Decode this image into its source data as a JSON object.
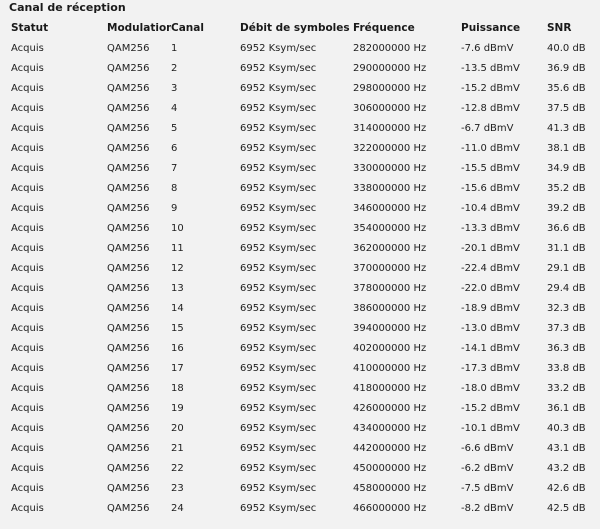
{
  "section": {
    "title": "Canal de réception"
  },
  "table": {
    "headers": {
      "status": "Statut",
      "modulation": "Modulation",
      "channel": "Canal",
      "symbol_rate": "Débit de symboles",
      "frequency": "Fréquence",
      "power": "Puissance",
      "snr": "SNR"
    },
    "rows": [
      {
        "status": "Acquis",
        "modulation": "QAM256",
        "channel": "1",
        "symbol_rate": "6952 Ksym/sec",
        "frequency": "282000000 Hz",
        "power": "-7.6 dBmV",
        "snr": "40.0 dB"
      },
      {
        "status": "Acquis",
        "modulation": "QAM256",
        "channel": "2",
        "symbol_rate": "6952 Ksym/sec",
        "frequency": "290000000 Hz",
        "power": "-13.5 dBmV",
        "snr": "36.9 dB"
      },
      {
        "status": "Acquis",
        "modulation": "QAM256",
        "channel": "3",
        "symbol_rate": "6952 Ksym/sec",
        "frequency": "298000000 Hz",
        "power": "-15.2 dBmV",
        "snr": "35.6 dB"
      },
      {
        "status": "Acquis",
        "modulation": "QAM256",
        "channel": "4",
        "symbol_rate": "6952 Ksym/sec",
        "frequency": "306000000 Hz",
        "power": "-12.8 dBmV",
        "snr": "37.5 dB"
      },
      {
        "status": "Acquis",
        "modulation": "QAM256",
        "channel": "5",
        "symbol_rate": "6952 Ksym/sec",
        "frequency": "314000000 Hz",
        "power": "-6.7 dBmV",
        "snr": "41.3 dB"
      },
      {
        "status": "Acquis",
        "modulation": "QAM256",
        "channel": "6",
        "symbol_rate": "6952 Ksym/sec",
        "frequency": "322000000 Hz",
        "power": "-11.0 dBmV",
        "snr": "38.1 dB"
      },
      {
        "status": "Acquis",
        "modulation": "QAM256",
        "channel": "7",
        "symbol_rate": "6952 Ksym/sec",
        "frequency": "330000000 Hz",
        "power": "-15.5 dBmV",
        "snr": "34.9 dB"
      },
      {
        "status": "Acquis",
        "modulation": "QAM256",
        "channel": "8",
        "symbol_rate": "6952 Ksym/sec",
        "frequency": "338000000 Hz",
        "power": "-15.6 dBmV",
        "snr": "35.2 dB"
      },
      {
        "status": "Acquis",
        "modulation": "QAM256",
        "channel": "9",
        "symbol_rate": "6952 Ksym/sec",
        "frequency": "346000000 Hz",
        "power": "-10.4 dBmV",
        "snr": "39.2 dB"
      },
      {
        "status": "Acquis",
        "modulation": "QAM256",
        "channel": "10",
        "symbol_rate": "6952 Ksym/sec",
        "frequency": "354000000 Hz",
        "power": "-13.3 dBmV",
        "snr": "36.6 dB"
      },
      {
        "status": "Acquis",
        "modulation": "QAM256",
        "channel": "11",
        "symbol_rate": "6952 Ksym/sec",
        "frequency": "362000000 Hz",
        "power": "-20.1 dBmV",
        "snr": "31.1 dB"
      },
      {
        "status": "Acquis",
        "modulation": "QAM256",
        "channel": "12",
        "symbol_rate": "6952 Ksym/sec",
        "frequency": "370000000 Hz",
        "power": "-22.4 dBmV",
        "snr": "29.1 dB"
      },
      {
        "status": "Acquis",
        "modulation": "QAM256",
        "channel": "13",
        "symbol_rate": "6952 Ksym/sec",
        "frequency": "378000000 Hz",
        "power": "-22.0 dBmV",
        "snr": "29.4 dB"
      },
      {
        "status": "Acquis",
        "modulation": "QAM256",
        "channel": "14",
        "symbol_rate": "6952 Ksym/sec",
        "frequency": "386000000 Hz",
        "power": "-18.9 dBmV",
        "snr": "32.3 dB"
      },
      {
        "status": "Acquis",
        "modulation": "QAM256",
        "channel": "15",
        "symbol_rate": "6952 Ksym/sec",
        "frequency": "394000000 Hz",
        "power": "-13.0 dBmV",
        "snr": "37.3 dB"
      },
      {
        "status": "Acquis",
        "modulation": "QAM256",
        "channel": "16",
        "symbol_rate": "6952 Ksym/sec",
        "frequency": "402000000 Hz",
        "power": "-14.1 dBmV",
        "snr": "36.3 dB"
      },
      {
        "status": "Acquis",
        "modulation": "QAM256",
        "channel": "17",
        "symbol_rate": "6952 Ksym/sec",
        "frequency": "410000000 Hz",
        "power": "-17.3 dBmV",
        "snr": "33.8 dB"
      },
      {
        "status": "Acquis",
        "modulation": "QAM256",
        "channel": "18",
        "symbol_rate": "6952 Ksym/sec",
        "frequency": "418000000 Hz",
        "power": "-18.0 dBmV",
        "snr": "33.2 dB"
      },
      {
        "status": "Acquis",
        "modulation": "QAM256",
        "channel": "19",
        "symbol_rate": "6952 Ksym/sec",
        "frequency": "426000000 Hz",
        "power": "-15.2 dBmV",
        "snr": "36.1 dB"
      },
      {
        "status": "Acquis",
        "modulation": "QAM256",
        "channel": "20",
        "symbol_rate": "6952 Ksym/sec",
        "frequency": "434000000 Hz",
        "power": "-10.1 dBmV",
        "snr": "40.3 dB"
      },
      {
        "status": "Acquis",
        "modulation": "QAM256",
        "channel": "21",
        "symbol_rate": "6952 Ksym/sec",
        "frequency": "442000000 Hz",
        "power": "-6.6 dBmV",
        "snr": "43.1 dB"
      },
      {
        "status": "Acquis",
        "modulation": "QAM256",
        "channel": "22",
        "symbol_rate": "6952 Ksym/sec",
        "frequency": "450000000 Hz",
        "power": "-6.2 dBmV",
        "snr": "43.2 dB"
      },
      {
        "status": "Acquis",
        "modulation": "QAM256",
        "channel": "23",
        "symbol_rate": "6952 Ksym/sec",
        "frequency": "458000000 Hz",
        "power": "-7.5 dBmV",
        "snr": "42.6 dB"
      },
      {
        "status": "Acquis",
        "modulation": "QAM256",
        "channel": "24",
        "symbol_rate": "6952 Ksym/sec",
        "frequency": "466000000 Hz",
        "power": "-8.2 dBmV",
        "snr": "42.5 dB"
      }
    ]
  }
}
